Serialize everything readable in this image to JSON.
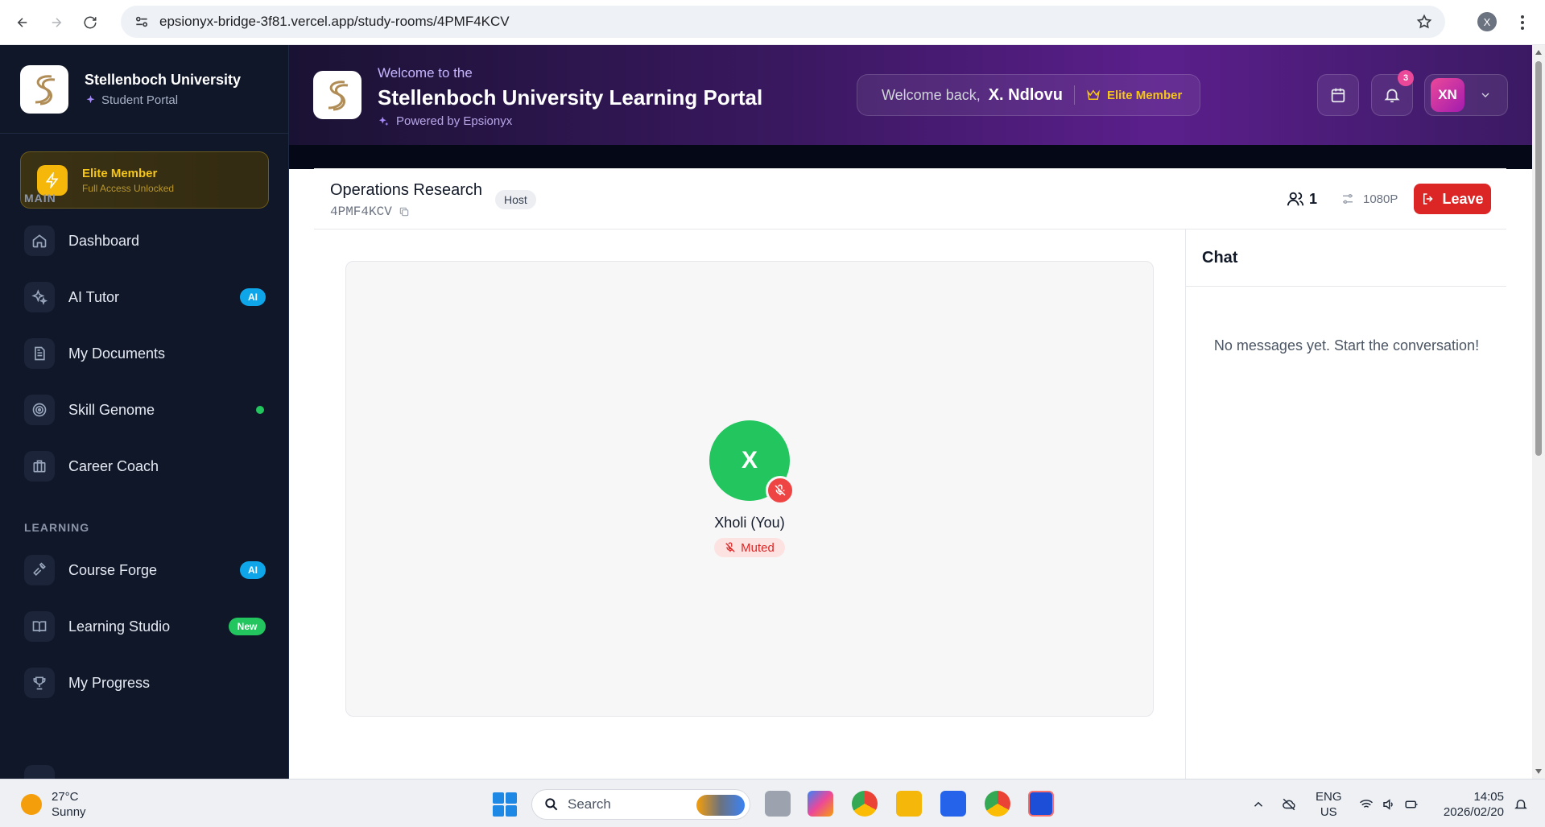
{
  "browser": {
    "url": "epsionyx-bridge-3f81.vercel.app/study-rooms/4PMF4KCV",
    "profile_initial": "X"
  },
  "sidebar": {
    "brand_name": "Stellenboch University",
    "brand_sub": "Student Portal",
    "elite_title": "Elite Member",
    "elite_sub": "Full Access Unlocked",
    "section_main": "MAIN",
    "section_learning": "LEARNING",
    "items": [
      {
        "label": "Dashboard",
        "icon": "home-icon"
      },
      {
        "label": "AI Tutor",
        "icon": "sparkles-icon",
        "badge": "AI"
      },
      {
        "label": "My Documents",
        "icon": "document-icon"
      },
      {
        "label": "Skill Genome",
        "icon": "target-icon",
        "dot": true
      },
      {
        "label": "Career Coach",
        "icon": "briefcase-icon"
      },
      {
        "label": "Course Forge",
        "icon": "hammer-icon",
        "badge": "AI"
      },
      {
        "label": "Learning Studio",
        "icon": "book-icon",
        "badge": "New"
      },
      {
        "label": "My Progress",
        "icon": "trophy-icon"
      }
    ]
  },
  "header": {
    "welcome_small": "Welcome to the",
    "portal_title": "Stellenboch University Learning Portal",
    "powered_by": "Powered by Epsionyx",
    "welcome_back": "Welcome back,",
    "user_name": "X. Ndlovu",
    "membership": "Elite Member",
    "notification_count": "3",
    "avatar_initials": "XN"
  },
  "room": {
    "title": "Operations Research",
    "code": "4PMF4KCV",
    "role": "Host",
    "participant_count": "1",
    "quality": "1080P",
    "leave_label": "Leave",
    "participant": {
      "initial": "X",
      "name": "Xholi (You)",
      "status": "Muted",
      "avatar_color": "#22c55e"
    }
  },
  "chat": {
    "title": "Chat",
    "empty_message": "No messages yet. Start the conversation!"
  },
  "taskbar": {
    "temperature": "27°C",
    "weather": "Sunny",
    "search_placeholder": "Search",
    "lang_top": "ENG",
    "lang_bottom": "US",
    "time": "14:05",
    "date": "2026/02/20"
  },
  "colors": {
    "sidebar_bg": "#0f1729",
    "accent_purple": "#5b1f8c",
    "leave_red": "#dc2626",
    "elite_gold": "#f5c518"
  }
}
